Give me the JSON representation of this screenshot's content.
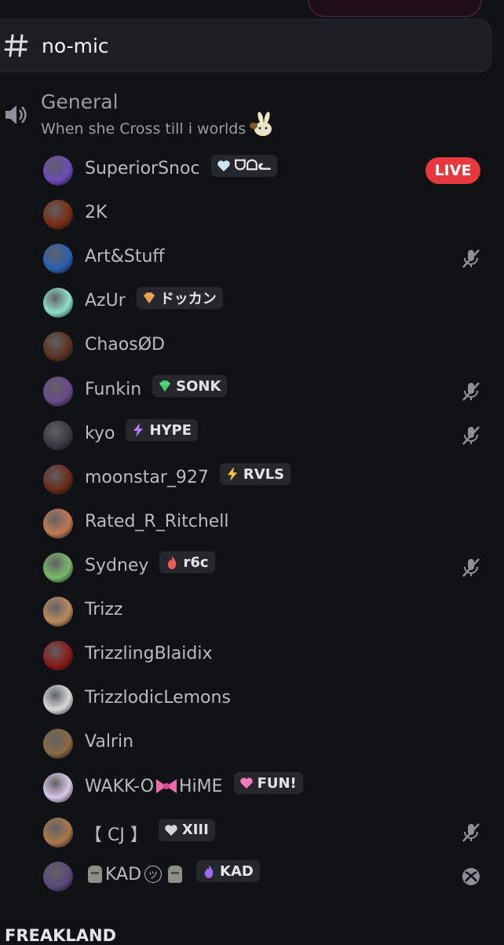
{
  "channel": {
    "hash": "#",
    "name": "no-mic"
  },
  "voice_channel": {
    "name": "General",
    "status": "When she Cross till i worlds"
  },
  "members": [
    {
      "name": "SuperiorSnoc",
      "tag": "ᗜᗝᓚ",
      "tag_icon": "white-heart-icon",
      "right": "live",
      "live_label": "LIVE",
      "avatar_color": "#6b4bb8"
    },
    {
      "name": "2K",
      "tag": null,
      "right": null,
      "avatar_color": "#7a2d14"
    },
    {
      "name": "Art&Stuff",
      "tag": null,
      "right": "mic-muted",
      "avatar_color": "#2a5fb0"
    },
    {
      "name": "AzUr",
      "tag": "ドッカン",
      "tag_icon": "orange-diamond-icon",
      "right": null,
      "avatar_color": "#8fe0c8"
    },
    {
      "name": "ChaosØD",
      "tag": null,
      "right": null,
      "avatar_color": "#5a3322"
    },
    {
      "name": "Funkin",
      "tag": "SONK",
      "tag_icon": "green-gem-icon",
      "right": "mic-muted",
      "avatar_color": "#6a4a8a"
    },
    {
      "name": "kyo",
      "tag": "HYPE",
      "tag_icon": "purple-bolt-icon",
      "right": "mic-muted",
      "avatar_color": "#3a3a44"
    },
    {
      "name": "moonstar_927",
      "tag": "RVLS",
      "tag_icon": "yellow-bolt-icon",
      "right": null,
      "avatar_color": "#6b2a1c"
    },
    {
      "name": "Rated_R_Ritchell",
      "tag": null,
      "right": null,
      "avatar_color": "#c07a52"
    },
    {
      "name": "Sydney",
      "tag": "r6c",
      "tag_icon": "red-flame-icon",
      "right": "mic-muted",
      "avatar_color": "#7ab86a"
    },
    {
      "name": "Trizz",
      "tag": null,
      "right": null,
      "avatar_color": "#b98a5e"
    },
    {
      "name": "TrizzlingBlaidix",
      "tag": null,
      "right": null,
      "avatar_color": "#8a1a1a"
    },
    {
      "name": "TrizzlodicLemons",
      "tag": null,
      "right": null,
      "avatar_color": "#d8d8d8"
    },
    {
      "name": "Valrin",
      "tag": null,
      "right": null,
      "avatar_color": "#8a6a44"
    },
    {
      "name": "WAKK-O",
      "name_suffix": "HiME",
      "tag": "FUN!",
      "tag_icon": "pink-heart-icon",
      "right": null,
      "avatar_color": "#d8c8e8"
    },
    {
      "name": "【 CJ 】",
      "tag": "XIII",
      "tag_icon": "grey-heart-icon",
      "right": "mic-muted",
      "avatar_color": "#a8784a"
    },
    {
      "name": "KAD",
      "tag": "KAD",
      "tag_icon": "purple-flame-icon",
      "right": "xbox",
      "avatar_color": "#5a4a7a"
    }
  ],
  "next_section": "FREAKLAND",
  "colors": {
    "live": "#e5393e",
    "background": "#111216"
  }
}
